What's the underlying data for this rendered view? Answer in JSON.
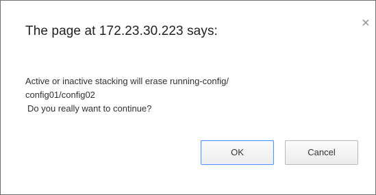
{
  "dialog": {
    "title": "The page at 172.23.30.223 says:",
    "message_lines": [
      "Active or inactive stacking will erase running-config/",
      "config01/config02",
      "Do you really want to continue?"
    ],
    "ok_label": "OK",
    "cancel_label": "Cancel",
    "close_icon": "close-icon"
  },
  "colors": {
    "focus_border": "#4d90fe",
    "dialog_border": "#6f6f6f"
  }
}
